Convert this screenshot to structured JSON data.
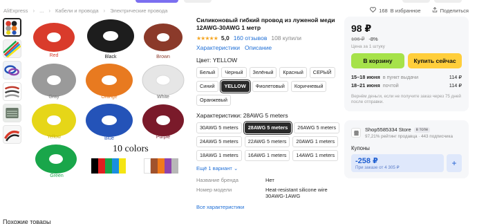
{
  "colors": {
    "accent_link": "#1f6fd6",
    "cart_button": "#a6e24a",
    "buy_button": "#ffce3b",
    "coupon_bg": "#dfe8fb",
    "star": "#f5a623"
  },
  "breadcrumb": {
    "items": [
      "AliExpress",
      "...",
      "Кабели и провода",
      "Электрические провода"
    ],
    "sep_icon": "chevron-right-icon"
  },
  "top_actions": {
    "favorites_count": "168",
    "favorites_label": "В избранное",
    "share_label": "Поделиться"
  },
  "gallery": {
    "thumb_count": 6,
    "active_index": 0,
    "coil_labels": [
      "Red",
      "Black",
      "Brown",
      "Gray",
      "Orange",
      "White",
      "Yellow",
      "Blue",
      "Purple",
      "Green"
    ],
    "colors_caption": "10 colors",
    "swatch_colors": [
      "#000000",
      "#e02020",
      "#19a64a",
      "#1a8fe0",
      "#f5e512",
      "#ffffff",
      "#a0522d",
      "#f07a1a",
      "#8e44ad",
      "#b8b8b8"
    ]
  },
  "product": {
    "title": "Силиконовый гибкий провод из луженой меди 12AWG-30AWG 1 метр",
    "rating": "5,0",
    "reviews": "160 отзывов",
    "sold": "108 купили",
    "link_specs": "Характеристики",
    "link_desc": "Описание",
    "color_label": "Цвет: YELLOW",
    "color_options": [
      "Белый",
      "Черный",
      "Зелёный",
      "Красный",
      "СЕРЫЙ",
      "Синий",
      "YELLOW",
      "Фиолетовый",
      "Коричневый",
      "Оранжевый"
    ],
    "color_selected": "YELLOW",
    "size_label": "Характеристики: 28AWG 5 meters",
    "size_options": [
      "30AWG 5 meters",
      "28AWG 5 meters",
      "26AWG 5 meters",
      "24AWG 5 meters",
      "22AWG 5 meters",
      "20AWG 1 meters",
      "18AWG 1 meters",
      "16AWG 1 meters",
      "14AWG 1 meters"
    ],
    "size_selected": "28AWG 5 meters",
    "more_variants": "Ещё 1 вариант",
    "specs": [
      {
        "key": "Название бренда",
        "value": "Нет"
      },
      {
        "key": "Номер модели",
        "value": "Heat-resistant silicone wire 30AWG-1AWG"
      }
    ],
    "all_specs": "Все характеристики"
  },
  "buy": {
    "price": "98 ₽",
    "old_price": "106 ₽",
    "discount": "-8%",
    "unit_note": "Цена за 1 штуку",
    "cart_label": "В корзину",
    "buy_label": "Купить сейчас",
    "delivery": [
      {
        "date": "15–18 июня",
        "place": "в пункт выдачи",
        "price": "114 ₽"
      },
      {
        "date": "18–21 июня",
        "place": "почтой",
        "price": "114 ₽"
      }
    ],
    "refund_note": "Вернём деньги, если не получите заказ через 75 дней после отправки."
  },
  "seller": {
    "name": "Shop5585334 Store",
    "badge": "в топе",
    "meta": "97,21% рейтинг продавца · 443 подписчика",
    "coupons_label": "Купоны",
    "coupon_value": "-258 ₽",
    "coupon_condition": "При заказе от 4 305 ₽",
    "coupon_add": "+"
  },
  "bottom": {
    "heading": "Похожие товары"
  }
}
